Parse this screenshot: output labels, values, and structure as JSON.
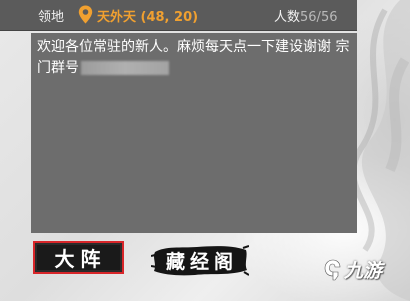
{
  "header": {
    "territory_label": "领地",
    "territory_name": "天外天 (48, 20)",
    "members_label": "人数",
    "members_count": "56/56",
    "location_icon": "location-pin-icon"
  },
  "notice": {
    "text": "欢迎各位常驻的新人。麻烦每天点一下建设谢谢 宗门群号"
  },
  "buttons": {
    "dazhen": "大阵",
    "cangjingge": "藏经阁"
  },
  "watermark": {
    "text": "九游"
  },
  "colors": {
    "header_bg": "#5b5b5b",
    "notice_bg": "#6d6d6d",
    "territory_name": "#f0a030",
    "active_button_border": "#d8262a"
  }
}
